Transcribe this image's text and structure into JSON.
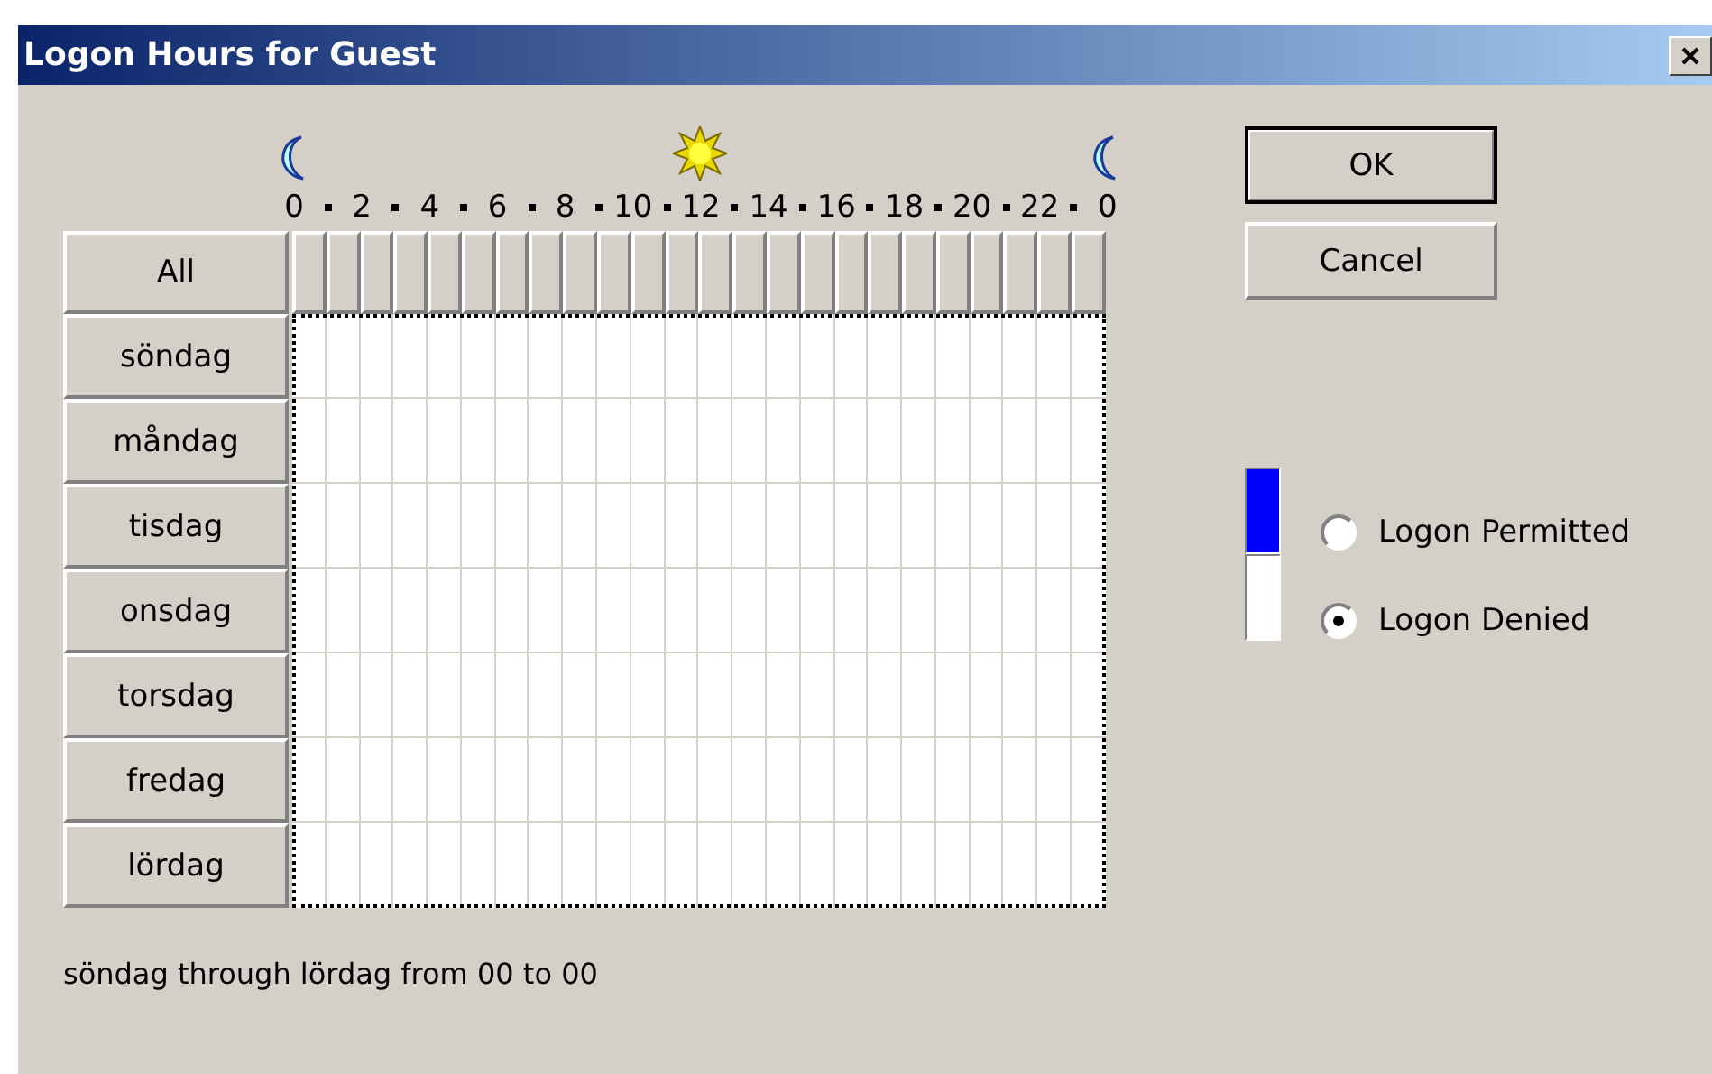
{
  "window": {
    "title": "Logon Hours for Guest"
  },
  "hour_labels": [
    "0",
    "2",
    "4",
    "6",
    "8",
    "10",
    "12",
    "14",
    "16",
    "18",
    "20",
    "22",
    "0"
  ],
  "all_button": "All",
  "days": [
    {
      "label": "söndag",
      "hours": [
        false,
        false,
        false,
        false,
        false,
        false,
        false,
        false,
        false,
        false,
        false,
        false,
        false,
        false,
        false,
        false,
        false,
        false,
        false,
        false,
        false,
        false,
        false,
        false
      ]
    },
    {
      "label": "måndag",
      "hours": [
        false,
        false,
        false,
        false,
        false,
        false,
        false,
        false,
        false,
        false,
        false,
        false,
        false,
        false,
        false,
        false,
        false,
        false,
        false,
        false,
        false,
        false,
        false,
        false
      ]
    },
    {
      "label": "tisdag",
      "hours": [
        false,
        false,
        false,
        false,
        false,
        false,
        false,
        false,
        false,
        false,
        false,
        false,
        false,
        false,
        false,
        false,
        false,
        false,
        false,
        false,
        false,
        false,
        false,
        false
      ]
    },
    {
      "label": "onsdag",
      "hours": [
        false,
        false,
        false,
        false,
        false,
        false,
        false,
        false,
        false,
        false,
        false,
        false,
        false,
        false,
        false,
        false,
        false,
        false,
        false,
        false,
        false,
        false,
        false,
        false
      ]
    },
    {
      "label": "torsdag",
      "hours": [
        false,
        false,
        false,
        false,
        false,
        false,
        false,
        false,
        false,
        false,
        false,
        false,
        false,
        false,
        false,
        false,
        false,
        false,
        false,
        false,
        false,
        false,
        false,
        false
      ]
    },
    {
      "label": "fredag",
      "hours": [
        false,
        false,
        false,
        false,
        false,
        false,
        false,
        false,
        false,
        false,
        false,
        false,
        false,
        false,
        false,
        false,
        false,
        false,
        false,
        false,
        false,
        false,
        false,
        false
      ]
    },
    {
      "label": "lördag",
      "hours": [
        false,
        false,
        false,
        false,
        false,
        false,
        false,
        false,
        false,
        false,
        false,
        false,
        false,
        false,
        false,
        false,
        false,
        false,
        false,
        false,
        false,
        false,
        false,
        false
      ]
    }
  ],
  "buttons": [
    {
      "label": "OK",
      "default": true
    },
    {
      "label": "Cancel",
      "default": false
    }
  ],
  "legend": [
    {
      "label": "Logon Permitted",
      "color": "#0000ff",
      "selected": false
    },
    {
      "label": "Logon Denied",
      "color": "#ffffff",
      "selected": true
    }
  ],
  "status": "söndag through lördag from 00 to 00"
}
